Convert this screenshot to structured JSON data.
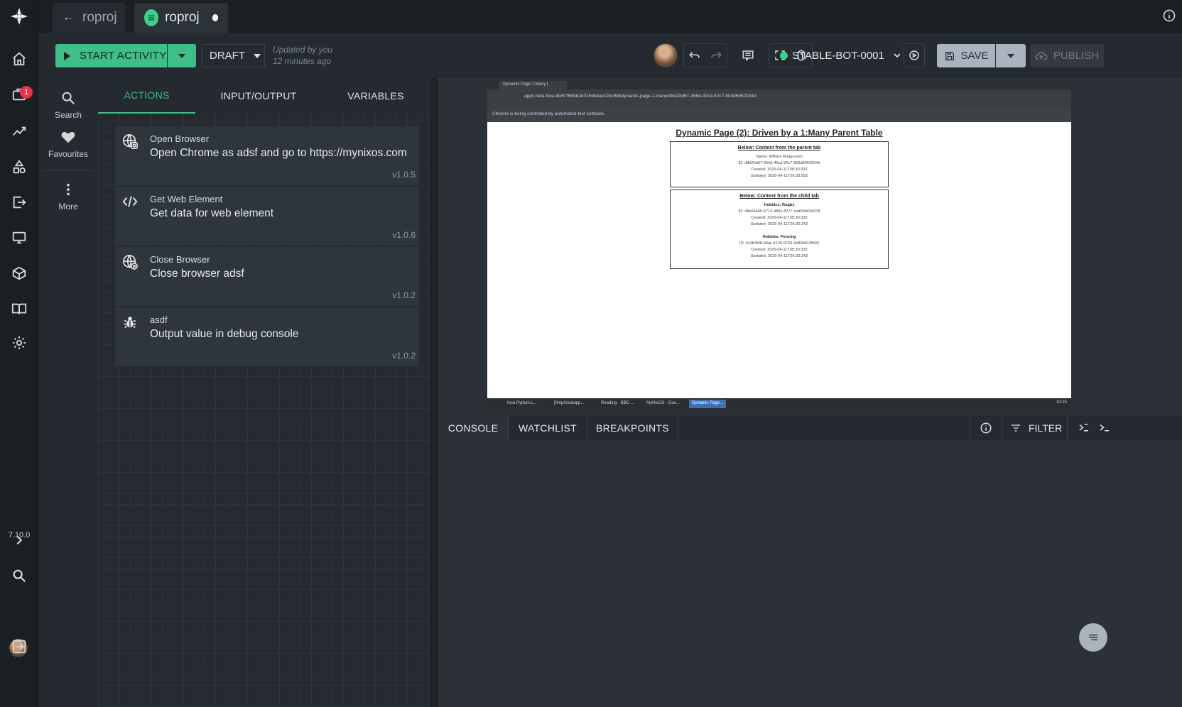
{
  "tabs": [
    {
      "label": "roproj"
    },
    {
      "label": "roproj"
    }
  ],
  "rail": {
    "notification_count": "1",
    "version": "7.10.0"
  },
  "toolbar": {
    "start_label": "START ACTIVITY",
    "draft_label": "DRAFT",
    "updated_line1": "Updated by you",
    "updated_line2": "12 minutes ago",
    "bot_name": "STABLE-BOT-0001",
    "save_label": "SAVE",
    "publish_label": "PUBLISH"
  },
  "sidebar2": {
    "search": "Search",
    "favourites": "Favourites",
    "more": "More"
  },
  "panel": {
    "tabs": [
      "ACTIONS",
      "INPUT/OUTPUT",
      "VARIABLES"
    ],
    "actions": [
      {
        "title": "Open Browser",
        "desc": "Open Chrome as adsf and go to https://mynixos.com",
        "version": "v1.0.5",
        "icon": "globe-icon"
      },
      {
        "title": "Get Web Element",
        "desc": "Get data for web element",
        "version": "v1.0.6",
        "icon": "code-icon"
      },
      {
        "title": "Close Browser",
        "desc": "Close browser adsf",
        "version": "v1.0.2",
        "icon": "globe-close-icon"
      },
      {
        "title": "asdf",
        "desc": "Output value in debug console",
        "version": "v1.0.2",
        "icon": "bug-icon"
      }
    ]
  },
  "screenshot": {
    "tab_title": "Dynamic Page 1:Many |",
    "address": "apps.beta.foca.lib/67f6b9b2e0159e4acc2fc498/dynamic-page-1-many/d8d20d67-456d-40cd-92c7-803d6952004d",
    "warning": "Chrome is being controlled by automated test software.",
    "page_title": "Dynamic Page (2): Driven by a 1:Many Parent Table",
    "parent_heading": "Below: Context from the parent tab",
    "parent_lines": [
      "Name: William Rodgerson",
      "ID: d8d20d67-456d-40cd-92c7-803d6952004d",
      "Created: 2025-04-11T05:30:33Z",
      "Updated: 2025-04-11T05:33:55Z"
    ],
    "child_heading": "Below: Context from the child tab",
    "child_1_title": "Hobbies: Rugby",
    "child_1_lines": [
      "ID: 48e64a05-6713-489c-8277-cad03b63e978",
      "Created: 2025-04-11T05:30:33Z",
      "Updated: 2025-04-11T05:30:34Z"
    ],
    "child_2_title": "Hobbies: Fencing",
    "child_2_lines": [
      "ID: 4c3b36f8-68ac-4126-9724-9e80b813fb03",
      "Created: 2025-04-11T05:30:33Z",
      "Updated: 2025-04-11T05:33:34Z"
    ],
    "taskbar": [
      "foca.Python.L...",
      "[/tmp/localapp...",
      "Reading - BBC ...",
      "MyNixOS - Goo...",
      "Dynamic Page..."
    ],
    "clock": "10:25"
  },
  "console": {
    "tabs": [
      "CONSOLE",
      "WATCHLIST",
      "BREAKPOINTS"
    ],
    "filter_label": "FILTER"
  },
  "colors": {
    "accent": "#3fbe88",
    "badge": "#e5334b"
  }
}
